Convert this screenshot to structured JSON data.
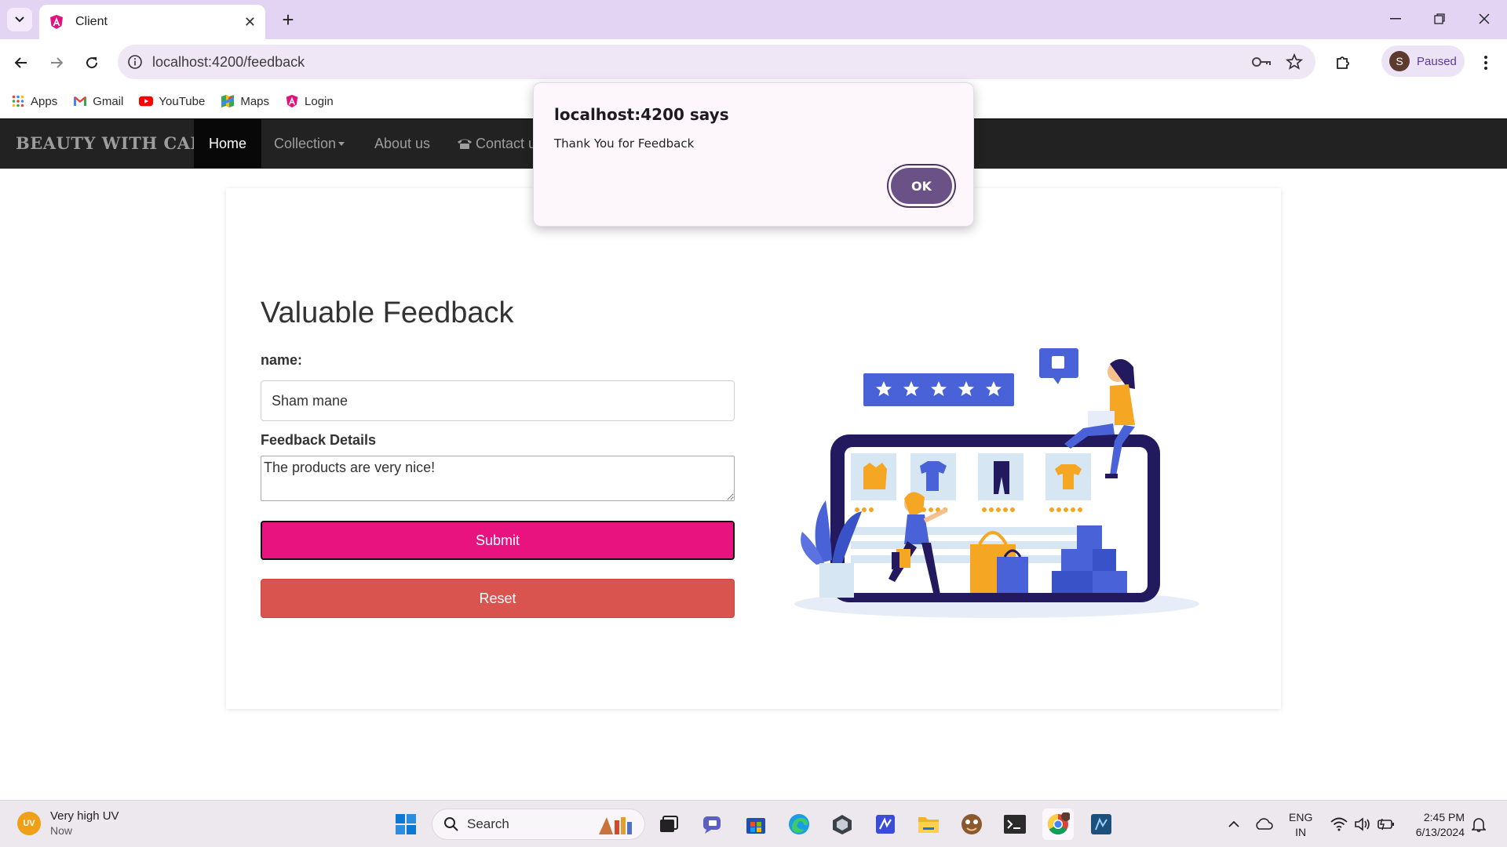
{
  "browser": {
    "tab_title": "Client",
    "tab_close": "✕",
    "new_tab": "+",
    "url": "localhost:4200/feedback",
    "profile_initial": "S",
    "profile_status": "Paused",
    "bookmarks": [
      {
        "label": "Apps",
        "icon": "apps-grid-icon"
      },
      {
        "label": "Gmail",
        "icon": "gmail-icon"
      },
      {
        "label": "YouTube",
        "icon": "youtube-icon"
      },
      {
        "label": "Maps",
        "icon": "maps-icon"
      },
      {
        "label": "Login",
        "icon": "angular-icon"
      }
    ]
  },
  "app": {
    "brand": "BEAUTY WITH CARE",
    "nav": [
      {
        "label": "Home",
        "active": true
      },
      {
        "label": "Collection"
      },
      {
        "label": "About us"
      },
      {
        "label": "Contact u"
      }
    ],
    "form": {
      "title": "Valuable Feedback",
      "name_label": "name:",
      "name_value": "Sham mane",
      "details_label": "Feedback Details",
      "details_value": "The products are very nice!",
      "submit_label": "Submit",
      "reset_label": "Reset"
    }
  },
  "dialog": {
    "title": "localhost:4200 says",
    "message": "Thank You for Feedback",
    "ok_label": "OK"
  },
  "taskbar": {
    "uv_badge": "UV",
    "weather_title": "Very high UV",
    "weather_sub": "Now",
    "search_placeholder": "Search",
    "lang_1": "ENG",
    "lang_2": "IN",
    "time": "2:45 PM",
    "date": "6/13/2024"
  },
  "colors": {
    "submit": "#e8137e",
    "reset": "#d9534f",
    "navbar": "#222222",
    "dialog_ok": "#6a5286"
  }
}
